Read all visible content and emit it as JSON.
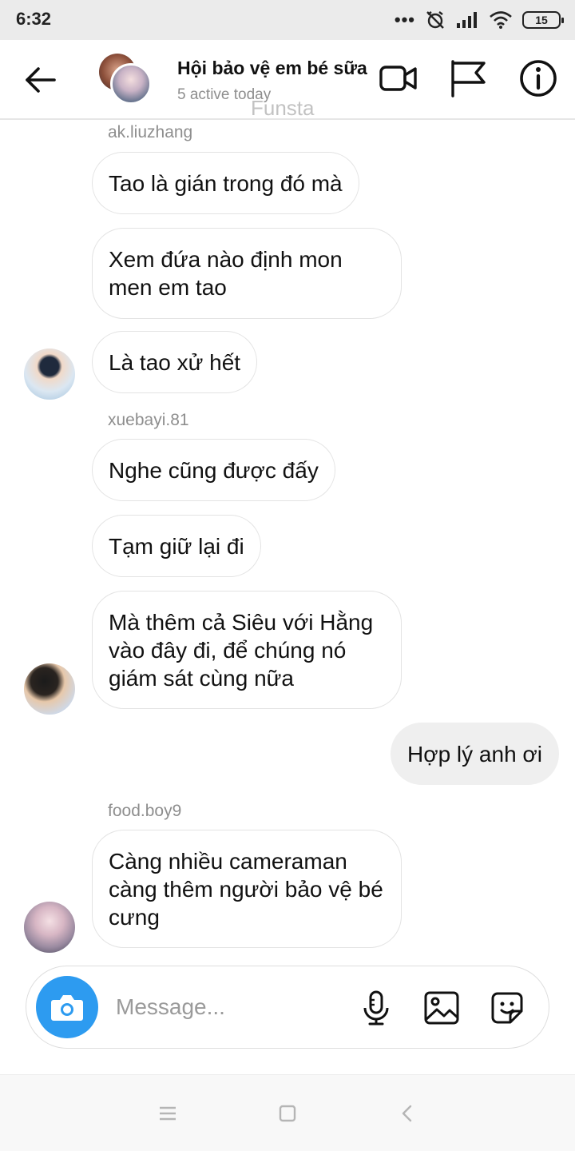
{
  "status_bar": {
    "time": "6:32",
    "dots": "•••",
    "battery": "15"
  },
  "header": {
    "title": "Hội bảo vệ em bé sữa",
    "subtitle": "5 active today",
    "watermark": "Funsta"
  },
  "messages": [
    {
      "sender": "ak.liuzhang",
      "texts": [
        "Tao là gián trong đó mà",
        "Xem đứa nào định mon men em tao",
        "Là tao xử hết"
      ]
    },
    {
      "sender": "xuebayi.81",
      "texts": [
        "Nghe cũng được đấy",
        "Tạm giữ lại đi",
        "Mà thêm cả Siêu với Hằng vào đây đi, để chúng nó giám sát cùng nữa"
      ]
    },
    {
      "mine": true,
      "texts": [
        "Hợp lý anh ơi"
      ]
    },
    {
      "sender": "food.boy9",
      "texts": [
        "Càng nhiều cameraman càng thêm người bảo vệ bé cưng"
      ]
    }
  ],
  "composer": {
    "placeholder": "Message..."
  },
  "icons": {
    "back": "arrow-left-icon",
    "video": "video-camera-icon",
    "flag": "flag-icon",
    "info": "info-icon",
    "camera": "camera-icon",
    "mic": "microphone-icon",
    "gallery": "image-icon",
    "sticker": "sticker-icon"
  },
  "colors": {
    "camera_button": "#2d9bf0",
    "my_bubble": "#efefef",
    "secondary_text": "#8e8e8e"
  }
}
